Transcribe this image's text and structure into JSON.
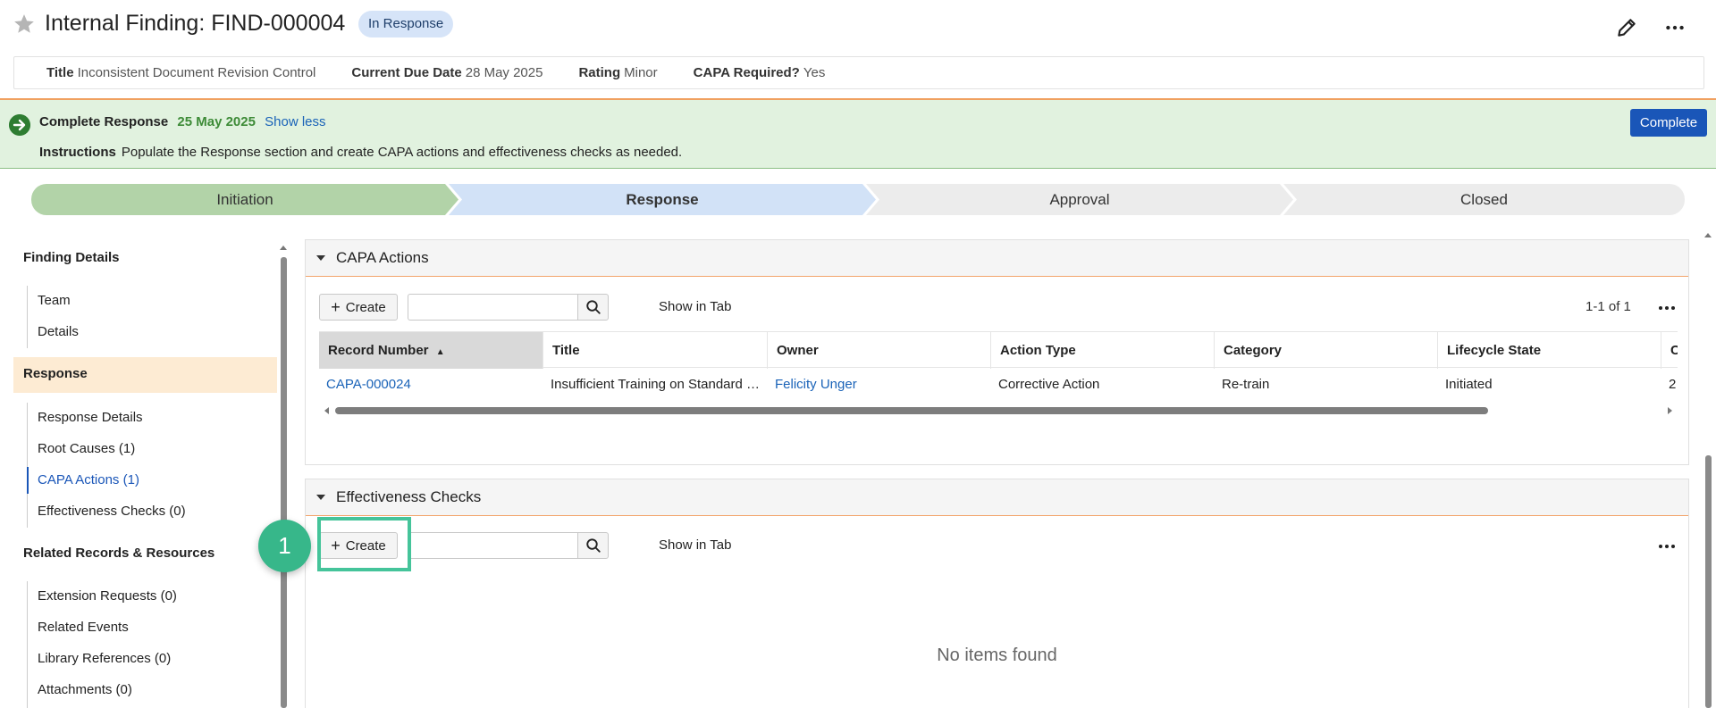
{
  "header": {
    "title": "Internal Finding: FIND-000004",
    "status": "In Response"
  },
  "info": {
    "title_label": "Title",
    "title_value": "Inconsistent Document Revision Control",
    "due_label": "Current Due Date",
    "due_value": "28 May 2025",
    "rating_label": "Rating",
    "rating_value": "Minor",
    "capa_label": "CAPA Required?",
    "capa_value": "Yes"
  },
  "banner": {
    "task": "Complete Response",
    "due": "25 May 2025",
    "toggle": "Show less",
    "instructions_label": "Instructions",
    "instructions": "Populate the Response section and create CAPA actions and effectiveness checks as needed.",
    "complete_button": "Complete",
    "accent_color": "#e1f2df"
  },
  "stages": [
    {
      "label": "Initiation"
    },
    {
      "label": "Response"
    },
    {
      "label": "Approval"
    },
    {
      "label": "Closed"
    }
  ],
  "nav": {
    "finding_details": "Finding Details",
    "team": "Team",
    "details": "Details",
    "response": "Response",
    "response_details": "Response Details",
    "root_causes": "Root Causes (1)",
    "capa_actions": "CAPA Actions (1)",
    "effectiveness_checks": "Effectiveness Checks (0)",
    "related": "Related Records & Resources",
    "extension_requests": "Extension Requests (0)",
    "related_events": "Related Events",
    "library_references": "Library References (0)",
    "attachments": "Attachments (0)"
  },
  "capa": {
    "section_title": "CAPA Actions",
    "create_label": "Create",
    "search_placeholder": "",
    "show_in_tab": "Show in Tab",
    "pager": "1-1 of 1",
    "columns": [
      "Record Number",
      "Title",
      "Owner",
      "Action Type",
      "Category",
      "Lifecycle State",
      "C"
    ],
    "rows": [
      {
        "record": "CAPA-000024",
        "title": "Insufficient Training on Standard Operating Procedures",
        "owner": "Felicity Unger",
        "action_type": "Corrective Action",
        "category": "Re-train",
        "state": "Initiated",
        "extra": "2"
      }
    ]
  },
  "effectiveness": {
    "section_title": "Effectiveness Checks",
    "create_label": "Create",
    "search_placeholder": "",
    "show_in_tab": "Show in Tab",
    "empty": "No items found"
  },
  "annotation": {
    "step": "1",
    "color": "#45c49a"
  }
}
